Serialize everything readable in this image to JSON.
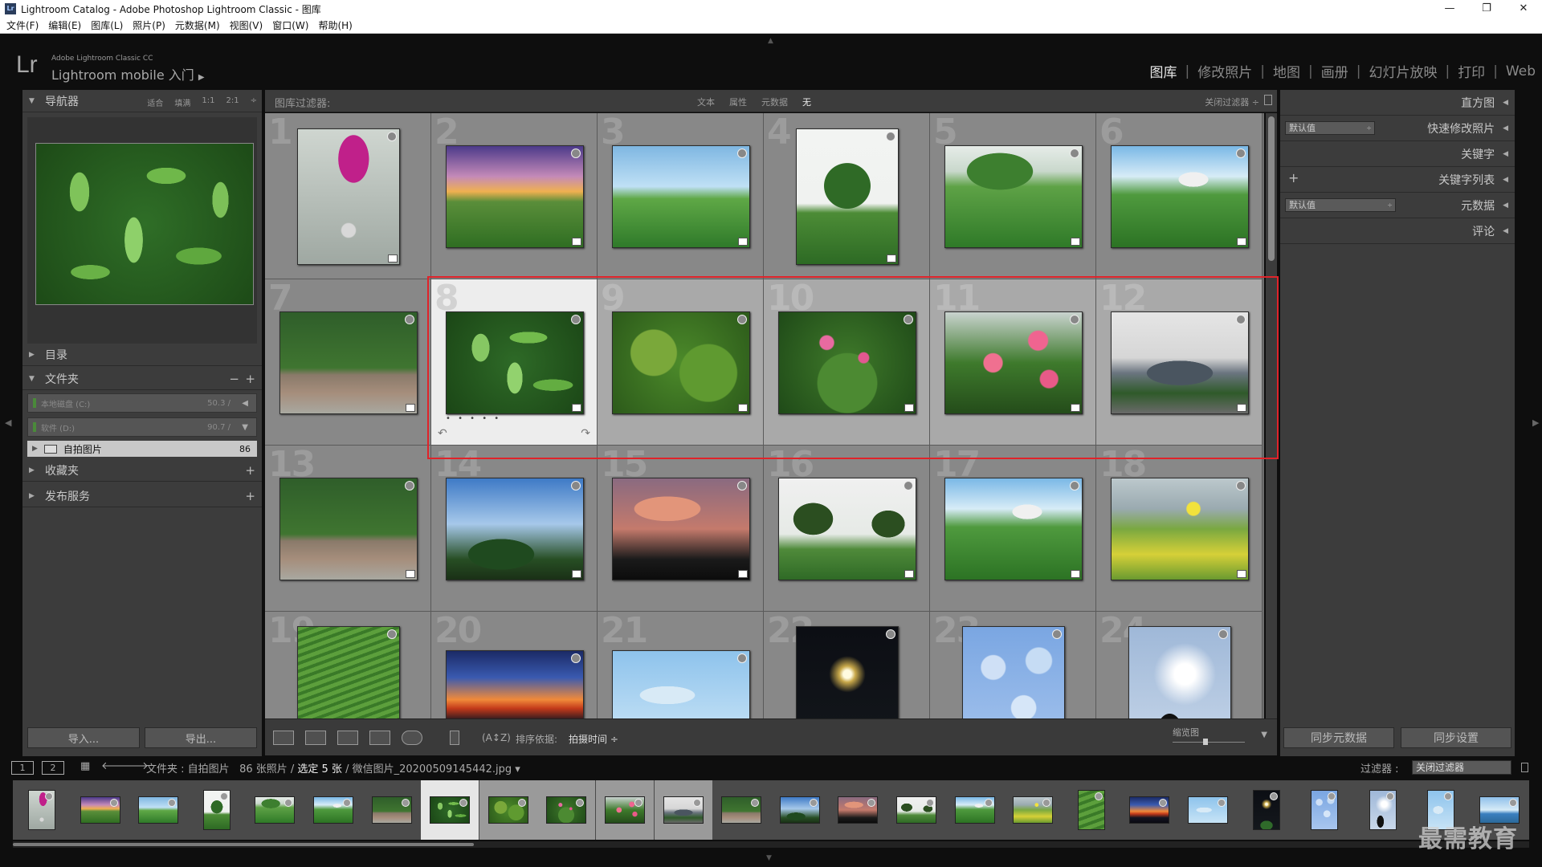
{
  "window": {
    "title": "Lightroom Catalog - Adobe Photoshop Lightroom Classic - 图库",
    "app_icon": "Lr",
    "controls": [
      "—",
      "❐",
      "✕"
    ]
  },
  "menubar": [
    "文件(F)",
    "编辑(E)",
    "图库(L)",
    "照片(P)",
    "元数据(M)",
    "视图(V)",
    "窗口(W)",
    "帮助(H)"
  ],
  "identity": {
    "logo": "Lr",
    "sub": "Adobe Lightroom Classic CC",
    "main": "Lightroom mobile 入门",
    "arrow": "▶"
  },
  "modules": [
    {
      "label": "图库",
      "active": true
    },
    {
      "label": "修改照片",
      "active": false
    },
    {
      "label": "地图",
      "active": false
    },
    {
      "label": "画册",
      "active": false
    },
    {
      "label": "幻灯片放映",
      "active": false
    },
    {
      "label": "打印",
      "active": false
    },
    {
      "label": "Web",
      "active": false
    }
  ],
  "left": {
    "navigator": {
      "title": "导航器",
      "opts": [
        "适合",
        "填满",
        "1:1",
        "2:1",
        "÷"
      ]
    },
    "catalog": {
      "title": "目录"
    },
    "folders": {
      "title": "文件夹",
      "minus": "−",
      "plus": "+",
      "volumes": [
        {
          "name": "本地磁盘 (C:)",
          "size": "50.3 /",
          "arrow": "◀"
        },
        {
          "name": "软件 (D:)",
          "size": "90.7 /",
          "arrow": "▼"
        }
      ],
      "selected": {
        "name": "自拍图片",
        "count": "86"
      }
    },
    "collections": {
      "title": "收藏夹",
      "plus": "+"
    },
    "publish": {
      "title": "发布服务",
      "plus": "+"
    },
    "import_label": "导入...",
    "export_label": "导出..."
  },
  "right": {
    "histogram": "直方图",
    "quick_develop": {
      "title": "快速修改照片",
      "preset": "默认值"
    },
    "keywording": "关键字",
    "keyword_list": {
      "title": "关键字列表",
      "plus": "+"
    },
    "metadata": {
      "title": "元数据",
      "preset": "默认值"
    },
    "comments": "评论",
    "sync_metadata": "同步元数据",
    "sync_settings": "同步设置"
  },
  "filter": {
    "label": "图库过滤器:",
    "modes": [
      "文本",
      "属性",
      "元数据",
      "无"
    ],
    "active_mode": "无",
    "close": "关闭过滤器 ÷"
  },
  "grid": {
    "cells": [
      {
        "n": "1",
        "img": "p-flower",
        "orient": "portrait",
        "state": "normal"
      },
      {
        "n": "2",
        "img": "p-sunset",
        "orient": "landscape",
        "state": "normal"
      },
      {
        "n": "3",
        "img": "p-field",
        "orient": "landscape",
        "state": "normal"
      },
      {
        "n": "4",
        "img": "p-tree",
        "orient": "portrait",
        "state": "normal"
      },
      {
        "n": "5",
        "img": "p-hills",
        "orient": "landscape",
        "state": "normal"
      },
      {
        "n": "6",
        "img": "p-house",
        "orient": "landscape",
        "state": "normal"
      },
      {
        "n": "7",
        "img": "p-wall",
        "orient": "landscape",
        "state": "normal"
      },
      {
        "n": "8",
        "img": "p-leaves",
        "orient": "landscape",
        "state": "active"
      },
      {
        "n": "9",
        "img": "p-bush",
        "orient": "landscape",
        "state": "selected"
      },
      {
        "n": "10",
        "img": "p-pinkbush",
        "orient": "landscape",
        "state": "selected"
      },
      {
        "n": "11",
        "img": "p-pinkflowers",
        "orient": "landscape",
        "state": "selected"
      },
      {
        "n": "12",
        "img": "p-building",
        "orient": "landscape",
        "state": "selected"
      },
      {
        "n": "13",
        "img": "p-wall",
        "orient": "landscape",
        "state": "normal"
      },
      {
        "n": "14",
        "img": "p-bluesky",
        "orient": "landscape",
        "state": "normal"
      },
      {
        "n": "15",
        "img": "p-dusk",
        "orient": "landscape",
        "state": "normal"
      },
      {
        "n": "16",
        "img": "p-trees2",
        "orient": "landscape",
        "state": "normal"
      },
      {
        "n": "17",
        "img": "p-house",
        "orient": "landscape",
        "state": "normal"
      },
      {
        "n": "18",
        "img": "p-yellow",
        "orient": "landscape",
        "state": "normal"
      },
      {
        "n": "19",
        "img": "p-rows",
        "orient": "portrait",
        "state": "normal"
      },
      {
        "n": "20",
        "img": "p-sunset2",
        "orient": "landscape",
        "state": "normal"
      },
      {
        "n": "21",
        "img": "p-cloudsky",
        "orient": "landscape",
        "state": "normal"
      },
      {
        "n": "22",
        "img": "p-night",
        "orient": "portrait",
        "state": "normal"
      },
      {
        "n": "23",
        "img": "p-mottled",
        "orient": "portrait",
        "state": "normal"
      },
      {
        "n": "24",
        "img": "p-silhouette",
        "orient": "portrait",
        "state": "normal"
      }
    ],
    "active_dots": "• • • • •",
    "rotate_left": "↶",
    "rotate_right": "↷"
  },
  "toolbar": {
    "sort_label": "排序依据:",
    "sort_value": "拍摄时间 ÷",
    "az": "(A↕Z)",
    "zoom_label": "缩览图",
    "menu": "▼"
  },
  "filmstrip_bar": {
    "monitor1": "1",
    "monitor2": "2",
    "source": "文件夹 : 自拍图片",
    "count": "86 张照片 /",
    "selected": "选定 5 张",
    "file": "/ 微信图片_20200509145442.jpg ▾",
    "filter_label": "过滤器 :",
    "filter_value": "关闭过滤器"
  },
  "filmstrip": [
    {
      "img": "p-flower",
      "state": "normal",
      "w": 34,
      "h": 50
    },
    {
      "img": "p-sunset",
      "state": "normal",
      "w": 50,
      "h": 34
    },
    {
      "img": "p-field",
      "state": "normal",
      "w": 50,
      "h": 34
    },
    {
      "img": "p-tree",
      "state": "normal",
      "w": 34,
      "h": 50
    },
    {
      "img": "p-hills",
      "state": "normal",
      "w": 50,
      "h": 34
    },
    {
      "img": "p-house",
      "state": "normal",
      "w": 50,
      "h": 34
    },
    {
      "img": "p-wall",
      "state": "normal",
      "w": 50,
      "h": 34
    },
    {
      "img": "p-leaves",
      "state": "active",
      "w": 50,
      "h": 34
    },
    {
      "img": "p-bush",
      "state": "selected",
      "w": 50,
      "h": 34
    },
    {
      "img": "p-pinkbush",
      "state": "selected",
      "w": 50,
      "h": 34
    },
    {
      "img": "p-pinkflowers",
      "state": "selected",
      "w": 50,
      "h": 34
    },
    {
      "img": "p-building",
      "state": "selected",
      "w": 50,
      "h": 34
    },
    {
      "img": "p-wall",
      "state": "normal",
      "w": 50,
      "h": 34
    },
    {
      "img": "p-bluesky",
      "state": "normal",
      "w": 50,
      "h": 34
    },
    {
      "img": "p-dusk",
      "state": "normal",
      "w": 50,
      "h": 34
    },
    {
      "img": "p-trees2",
      "state": "normal",
      "w": 50,
      "h": 34
    },
    {
      "img": "p-house",
      "state": "normal",
      "w": 50,
      "h": 34
    },
    {
      "img": "p-yellow",
      "state": "normal",
      "w": 50,
      "h": 34
    },
    {
      "img": "p-rows",
      "state": "normal",
      "w": 34,
      "h": 50
    },
    {
      "img": "p-sunset2",
      "state": "normal",
      "w": 50,
      "h": 34
    },
    {
      "img": "p-cloudsky",
      "state": "normal",
      "w": 50,
      "h": 34
    },
    {
      "img": "p-night",
      "state": "normal",
      "w": 34,
      "h": 50
    },
    {
      "img": "p-mottled",
      "state": "normal",
      "w": 34,
      "h": 50
    },
    {
      "img": "p-silhouette",
      "state": "normal",
      "w": 34,
      "h": 50
    },
    {
      "img": "p-cloudsky",
      "state": "normal",
      "w": 34,
      "h": 50
    },
    {
      "img": "p-lake",
      "state": "normal",
      "w": 50,
      "h": 34
    }
  ],
  "watermark": "最需教育",
  "colors": {
    "selection_box": "#e0232a",
    "active_cell": "#ededed",
    "selected_cell": "#a9a9a9"
  }
}
